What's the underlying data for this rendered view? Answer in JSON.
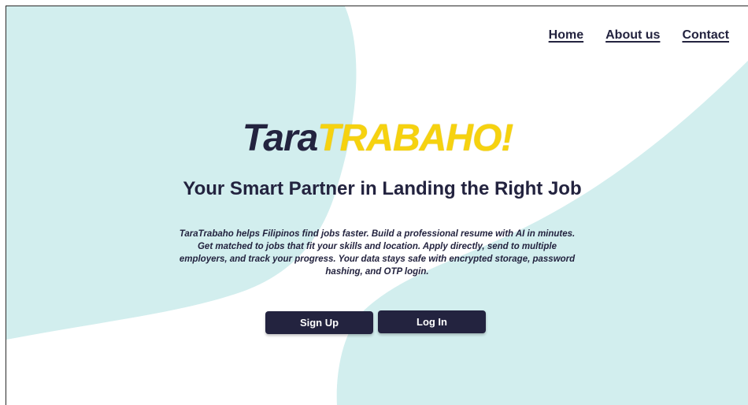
{
  "nav": {
    "home": "Home",
    "about": "About us",
    "contact": "Contact"
  },
  "logo": {
    "part1": "Tara",
    "part2": "TRABAHO!"
  },
  "hero": {
    "tagline": "Your Smart Partner in Landing the Right Job",
    "description": "TaraTrabaho helps Filipinos find jobs faster. Build a professional resume with AI in minutes. Get matched to jobs that fit your skills and location. Apply directly, send to multiple employers, and track your progress. Your data stays safe with encrypted storage, password hashing, and OTP login."
  },
  "buttons": {
    "signup": "Sign Up",
    "login": "Log In"
  },
  "colors": {
    "navy": "#23233f",
    "accent_yellow": "#f6d20f",
    "background_blob": "#d2eeee",
    "background": "#ffffff"
  }
}
